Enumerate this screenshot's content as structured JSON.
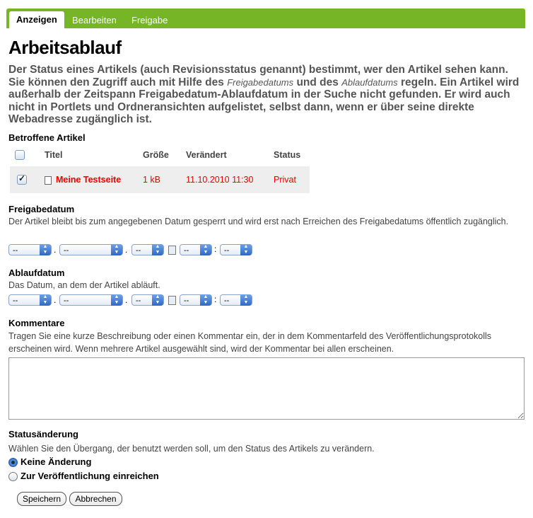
{
  "tabs": [
    "Anzeigen",
    "Bearbeiten",
    "Freigabe"
  ],
  "title": "Arbeitsablauf",
  "description": {
    "p1": "Der Status eines Artikels (auch Revisionsstatus genannt) bestimmt, wer den Artikel sehen kann. Sie können den Zugriff auch mit Hilfe des ",
    "i1": "Freigabedatums",
    "p2": " und des ",
    "i2": "Ablaufdatums",
    "p3": " regeln. Ein Artikel wird außerhalb der Zeitspann Freigabedatum-Ablaufdatum in der Suche nicht gefunden. Er wird auch nicht in Portlets und Ordneransichten aufgelistet, selbst dann, wenn er über seine direkte Webadresse zugänglich ist."
  },
  "affected": {
    "label": "Betroffene Artikel",
    "headers": [
      "Titel",
      "Größe",
      "Verändert",
      "Status"
    ],
    "rows": [
      {
        "title": "Meine Testseite",
        "size": "1 kB",
        "modified": "11.10.2010 11:30",
        "status": "Privat",
        "checked": true
      }
    ]
  },
  "effective": {
    "label": "Freigabedatum",
    "help": "Der Artikel bleibt bis zum angegebenen Datum gesperrt und wird erst nach Erreichen des Freigabedatums öffentlich zugänglich.",
    "year": "--",
    "month": "--",
    "day": "--",
    "hour": "--",
    "minute": "--"
  },
  "expiration": {
    "label": "Ablaufdatum",
    "help": "Das Datum, an dem der Artikel abläuft.",
    "year": "--",
    "month": "--",
    "day": "--",
    "hour": "--",
    "minute": "--"
  },
  "comments": {
    "label": "Kommentare",
    "help": "Tragen Sie eine kurze Beschreibung oder einen Kommentar ein, der in dem Kommentarfeld des Veröffentlichungsprotokolls erscheinen wird. Wenn mehrere Artikel ausgewählt sind, wird der Kommentar bei allen erscheinen.",
    "value": ""
  },
  "transition": {
    "label": "Statusänderung",
    "help": "Wählen Sie den Übergang, der benutzt werden soll, um den Status des Artikels zu verändern.",
    "options": [
      "Keine Änderung",
      "Zur Veröffentlichung einreichen"
    ],
    "selected": "Keine Änderung"
  },
  "buttons": {
    "save": "Speichern",
    "cancel": "Abbrechen"
  },
  "colors": {
    "tab_bar": "#76b525",
    "item_text": "#e00000"
  }
}
